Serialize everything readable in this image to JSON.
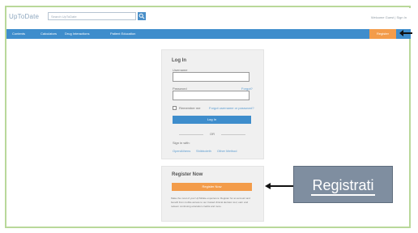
{
  "app": {
    "logo": "UpToDate"
  },
  "search": {
    "placeholder": "Search UpToDate"
  },
  "top_links": {
    "text": "Welcome Guest  |  Sign In"
  },
  "nav": {
    "items": [
      "Contents",
      "Calculators",
      "Drug Interactions",
      "Patient Education"
    ],
    "register": "Register"
  },
  "login": {
    "title": "Log In",
    "username_label": "Username",
    "password_label": "Password",
    "password_help": "Forgot?",
    "remember_label": "Remember me",
    "forgot_link": "Forgot username or password?",
    "submit": "Log In",
    "divider": "OR",
    "sign_in_with": "Sign in with:",
    "providers": [
      "OpenAthens",
      "Shibboleth",
      "Other Method"
    ]
  },
  "register": {
    "title": "Register Now",
    "button": "Register Now",
    "description": "Make the most of your UpToDate experience: Register for an account and benefit from mobile access to our trusted clinical decision tool, earn and redeem continuing education credits and more."
  },
  "annotation": {
    "callout": "Registrati"
  },
  "colors": {
    "nav_blue": "#3e8dcc",
    "accent_orange": "#f39c4a",
    "callout_gray": "#7f8ea0",
    "frame_green": "#b9d89a"
  }
}
